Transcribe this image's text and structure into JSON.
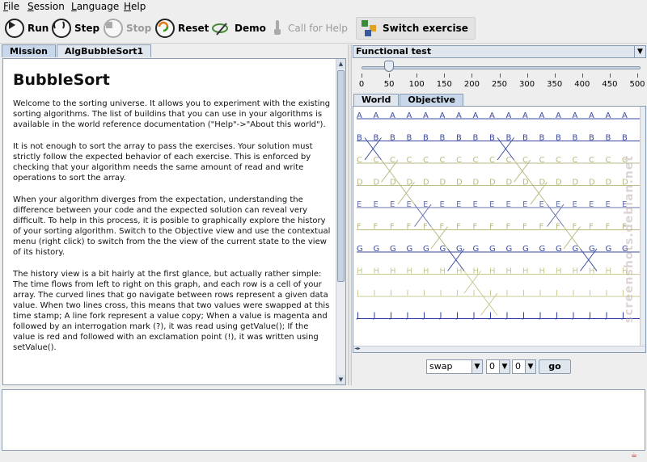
{
  "menu": [
    {
      "label": "File",
      "key": "F"
    },
    {
      "label": "Session",
      "key": "S"
    },
    {
      "label": "Language",
      "key": "L"
    },
    {
      "label": "Help",
      "key": "H"
    }
  ],
  "toolbar": {
    "run": "Run",
    "step": "Step",
    "stop": "Stop",
    "reset": "Reset",
    "demo": "Demo",
    "call_for_help": "Call for Help",
    "switch_exercise": "Switch exercise"
  },
  "left_tabs": [
    "Mission",
    "AlgBubbleSort1"
  ],
  "mission": {
    "title": "BubbleSort",
    "paragraphs": [
      "Welcome to the sorting universe. It allows you to experiment with the existing sorting algorithms. The list of buildins that you can use in your algorithms is available in the world reference documentation (\"Help\"->\"About this world\").",
      "It is not enough to sort the array to pass the exercises. Your solution must strictly follow the expected behavior of each exercise. This is enforced by checking that your algorithm needs the same amount of read and write operations to sort the array.",
      "When your algorithm diverges from the expectation, understanding the difference between your code and the expected solution can reveal very difficult. To help in this process, it is posible to graphically explore the history of your sorting algorithm. Switch to the Objective view and use the contextual menu (right click) to switch from the the view of the current state to the view of its history.",
      "The history view is a bit hairly at the first glance, but actually rather simple: The time flows from left to right on this graph, and each row is a cell of your array. The curved lines that go navigate between rows represent a given data value. When two lines cross, this means that two values were swapped at this time stamp; A line fork represent a value copy; When a value is magenta and followed by an interrogation mark (?), it was read using getValue(); If the value is red and followed with an exclamation point (!), it was written using setValue()."
    ]
  },
  "exercise_selector": "Functional test",
  "speed": {
    "ticks": [
      "0",
      "50",
      "100",
      "150",
      "200",
      "250",
      "300",
      "350",
      "400",
      "450",
      "500"
    ],
    "value": 50,
    "min": 0,
    "max": 500
  },
  "view_tabs": [
    "World",
    "Objective"
  ],
  "history": {
    "rows": [
      "A",
      "B",
      "C",
      "D",
      "E",
      "F",
      "G",
      "H",
      "I",
      "J"
    ],
    "row_colors": [
      "#3a4aa0",
      "#3a4aa0",
      "#b8b880",
      "#b8b880",
      "#6a74b0",
      "#b8b880",
      "#3a4aa0",
      "#c8c890",
      "#c8c890",
      "#2a3aa0"
    ]
  },
  "controls": {
    "operation": "swap",
    "index1": "0",
    "index2": "0",
    "go": "go"
  },
  "watermark": "screenshots.debian.net"
}
